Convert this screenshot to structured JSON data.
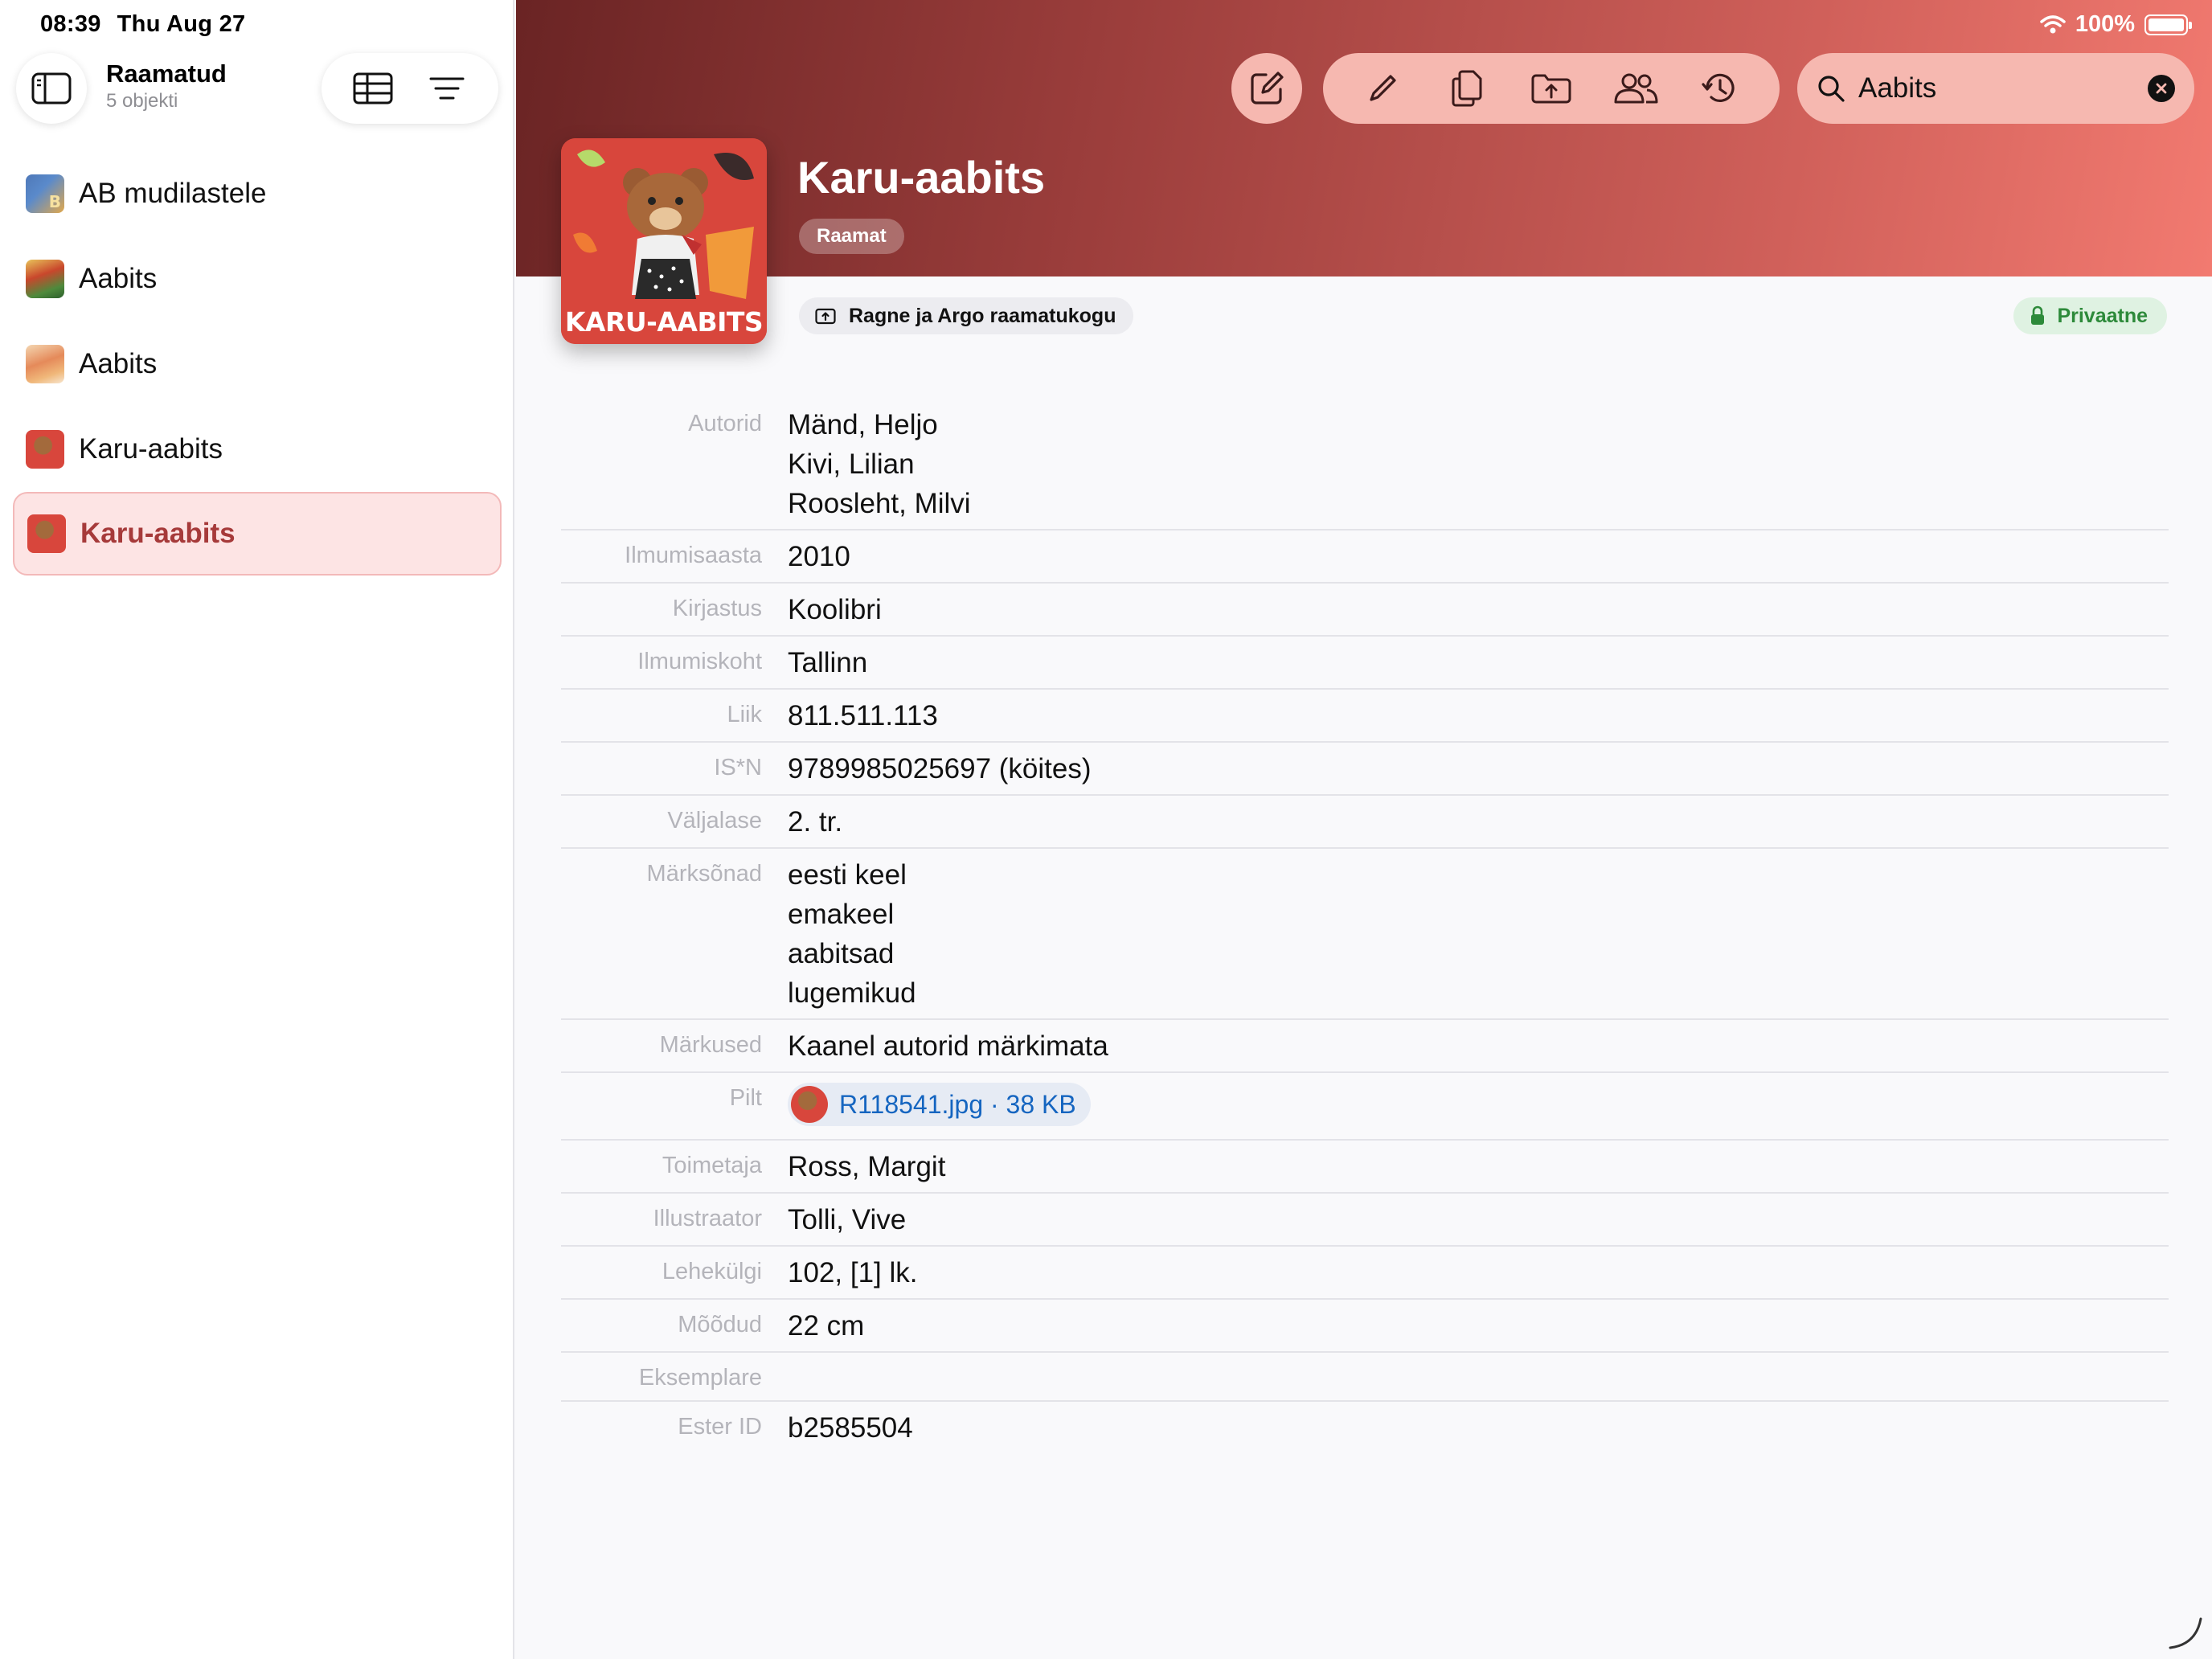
{
  "status": {
    "time": "08:39",
    "date": "Thu Aug 27",
    "battery": "100%"
  },
  "sidebar": {
    "title": "Raamatud",
    "count": "5 objekti",
    "items": [
      {
        "label": "AB mudilastele",
        "selected": false
      },
      {
        "label": "Aabits",
        "selected": false
      },
      {
        "label": "Aabits",
        "selected": false
      },
      {
        "label": "Karu-aabits",
        "selected": false
      },
      {
        "label": "Karu-aabits",
        "selected": true
      }
    ]
  },
  "search": {
    "value": "Aabits"
  },
  "record": {
    "cover_text": "KARU-AABITS",
    "title": "Karu-aabits",
    "type": "Raamat",
    "collection": "Ragne ja Argo raamatukogu",
    "visibility": "Privaatne",
    "fields": [
      {
        "label": "Autorid",
        "values": [
          "Mänd, Heljo",
          "Kivi, Lilian",
          "Roosleht, Milvi"
        ]
      },
      {
        "label": "Ilmumisaasta",
        "values": [
          "2010"
        ]
      },
      {
        "label": "Kirjastus",
        "values": [
          "Koolibri"
        ]
      },
      {
        "label": "Ilmumiskoht",
        "values": [
          "Tallinn"
        ]
      },
      {
        "label": "Liik",
        "values": [
          "811.511.113"
        ]
      },
      {
        "label": "IS*N",
        "values": [
          "9789985025697 (köites)"
        ]
      },
      {
        "label": "Väljalase",
        "values": [
          "2. tr."
        ]
      },
      {
        "label": "Märksõnad",
        "values": [
          "eesti keel",
          "emakeel",
          "aabitsad",
          "lugemikud"
        ]
      },
      {
        "label": "Märkused",
        "values": [
          "Kaanel autorid märkimata"
        ]
      },
      {
        "label": "Pilt",
        "file": "R118541.jpg · 38 KB"
      },
      {
        "label": "Toimetaja",
        "values": [
          "Ross, Margit"
        ]
      },
      {
        "label": "Illustraator",
        "values": [
          "Tolli, Vive"
        ]
      },
      {
        "label": "Lehekülgi",
        "values": [
          "102, [1] lk."
        ]
      },
      {
        "label": "Mõõdud",
        "values": [
          "22 cm"
        ]
      },
      {
        "label": "Eksemplare",
        "values": [
          ""
        ]
      },
      {
        "label": "Ester ID",
        "values": [
          "b2585504"
        ]
      }
    ]
  },
  "colors": {
    "accent": "#a63a3a",
    "header_start": "#6a2424",
    "header_end": "#f27a70",
    "link": "#1565c0",
    "private": "#2d8a3a"
  }
}
